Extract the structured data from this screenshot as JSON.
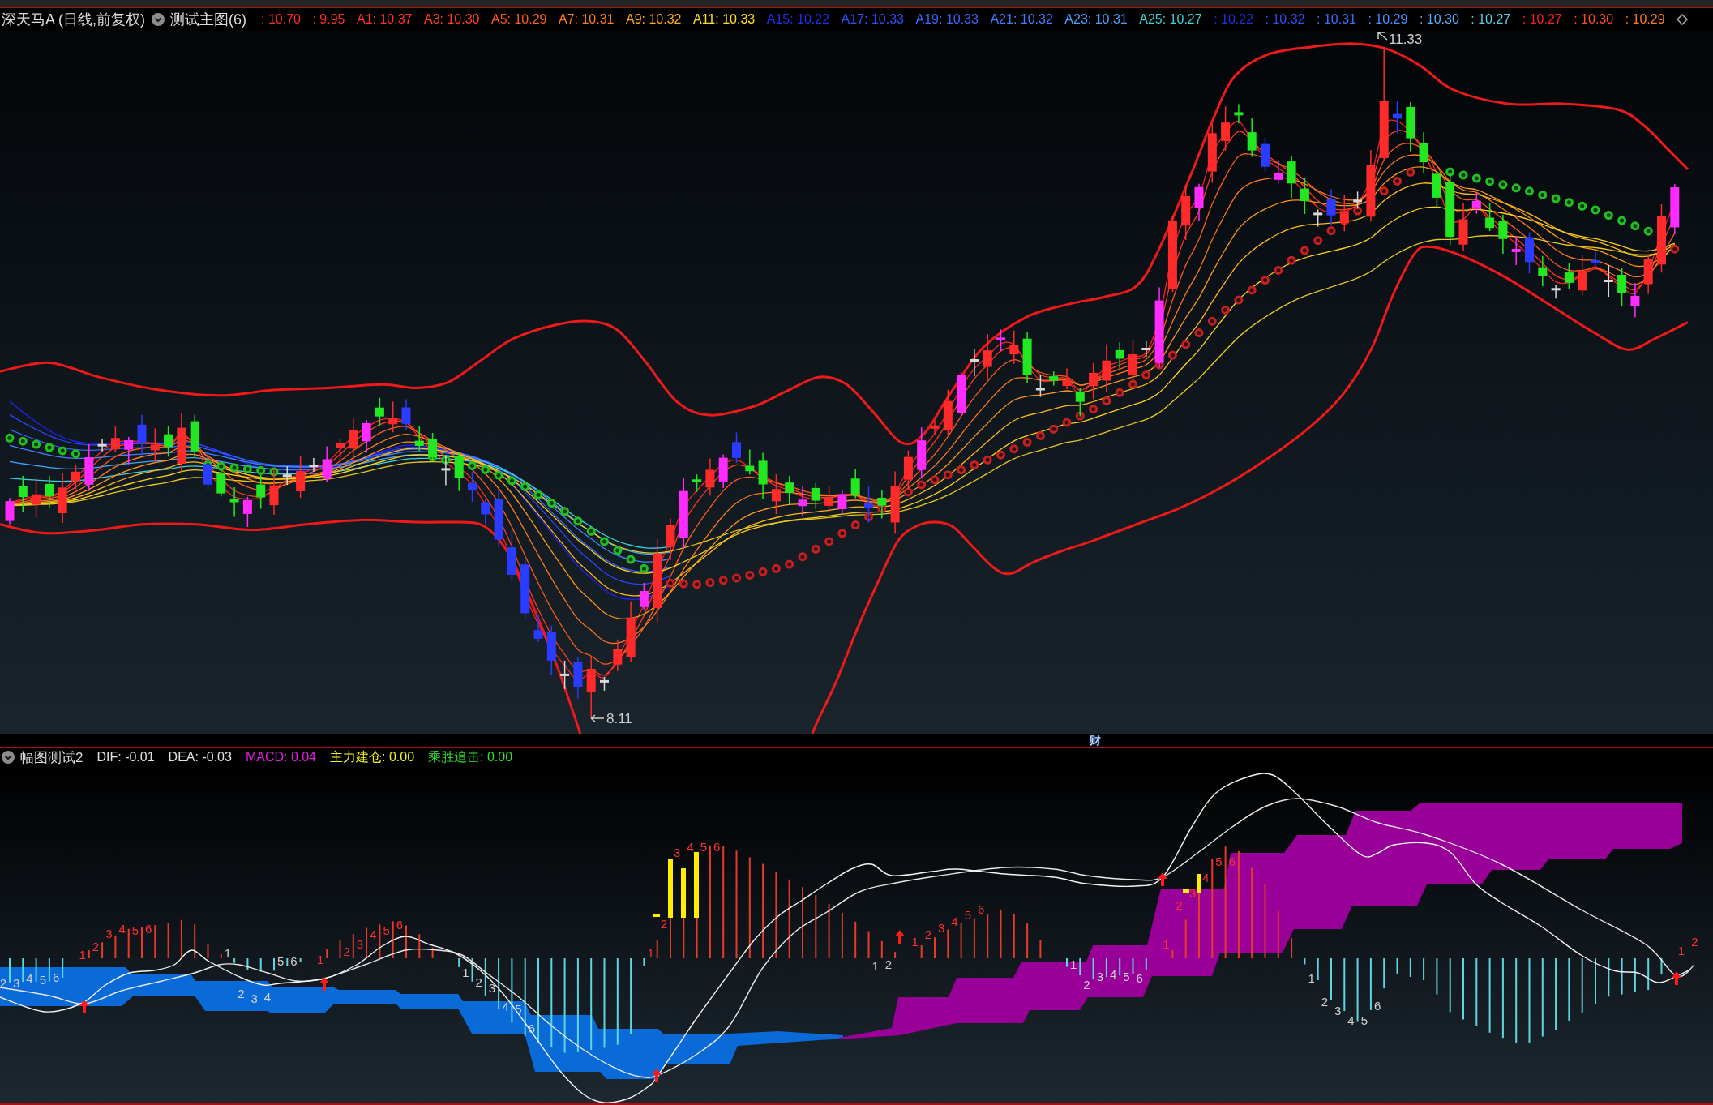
{
  "main_chart": {
    "title": "深天马A (日线,前复权)",
    "formula": "测试主图(6)",
    "readings": [
      {
        "text": ": 10.70",
        "color": "#ff2a2a"
      },
      {
        "text": ": 9.95",
        "color": "#ff2a2a"
      },
      {
        "text": "A1: 10.37",
        "color": "#ff3030"
      },
      {
        "text": "A3: 10.30",
        "color": "#ff4020"
      },
      {
        "text": "A5: 10.29",
        "color": "#ff5a20"
      },
      {
        "text": "A7: 10.31",
        "color": "#ff7a20"
      },
      {
        "text": "A9: 10.32",
        "color": "#ffa820"
      },
      {
        "text": "A11: 10.33",
        "color": "#ffe020"
      },
      {
        "text": "A15: 10.22",
        "color": "#2030f0"
      },
      {
        "text": "A17: 10.33",
        "color": "#3050ff"
      },
      {
        "text": "A19: 10.33",
        "color": "#3868ff"
      },
      {
        "text": "A21: 10.32",
        "color": "#4080ff"
      },
      {
        "text": "A23: 10.31",
        "color": "#48a0ff"
      },
      {
        "text": "A25: 10.27",
        "color": "#40d0d0"
      },
      {
        "text": ": 10.22",
        "color": "#2030e0"
      },
      {
        "text": ": 10.32",
        "color": "#2a50f0"
      },
      {
        "text": ": 10.31",
        "color": "#3a70ff"
      },
      {
        "text": ": 10.29",
        "color": "#4890ff"
      },
      {
        "text": ": 10.30",
        "color": "#50b0ff"
      },
      {
        "text": ": 10.27",
        "color": "#58d0e0"
      },
      {
        "text": ": 10.27",
        "color": "#ff2020"
      },
      {
        "text": ": 10.30",
        "color": "#ff4a20"
      },
      {
        "text": ": 10.29",
        "color": "#ff7a20"
      }
    ],
    "high_label": "11.33",
    "low_label": "8.11"
  },
  "divider": {
    "badge": "财"
  },
  "sub_chart": {
    "title": "幅图测试2",
    "readings": [
      {
        "text": "DIF: -0.01",
        "color": "#e0e0e0"
      },
      {
        "text": "DEA: -0.03",
        "color": "#e0e0e0"
      },
      {
        "text": "MACD: 0.04",
        "color": "#e020e0"
      },
      {
        "text": "主力建仓: 0.00",
        "color": "#f0f020"
      },
      {
        "text": "乘胜追击: 0.00",
        "color": "#30e030"
      }
    ],
    "count_labels": [
      {
        "kind": "down",
        "digits": [
          "2",
          "3",
          "4",
          "5",
          "6"
        ]
      },
      {
        "kind": "up",
        "digits": [
          "1",
          "2",
          "3",
          "4",
          "5",
          "6"
        ]
      },
      {
        "kind": "down",
        "digits": [
          "1",
          "2",
          "3",
          "4",
          "5",
          "6"
        ]
      },
      {
        "kind": "up",
        "digits": [
          "1",
          "2",
          "3",
          "4",
          "5",
          "6"
        ]
      },
      {
        "kind": "down",
        "digits": [
          "1",
          "2",
          "3",
          "4",
          "5",
          "6"
        ]
      },
      {
        "kind": "up",
        "digits": [
          "1",
          "2",
          "3",
          "4",
          "5",
          "6"
        ]
      },
      {
        "kind": "down",
        "digits": [
          "1",
          "2"
        ]
      },
      {
        "kind": "up",
        "digits": [
          "1",
          "2",
          "3",
          "4",
          "5",
          "6"
        ]
      },
      {
        "kind": "down",
        "digits": [
          "1",
          "2",
          "3",
          "4",
          "5",
          "6"
        ]
      },
      {
        "kind": "up",
        "digits": [
          "1",
          "2",
          "3",
          "4",
          "5",
          "6"
        ]
      },
      {
        "kind": "down",
        "digits": [
          "1",
          "2",
          "3",
          "4",
          "5",
          "6"
        ]
      },
      {
        "kind": "up",
        "digits": [
          "1",
          "2"
        ]
      }
    ]
  }
}
